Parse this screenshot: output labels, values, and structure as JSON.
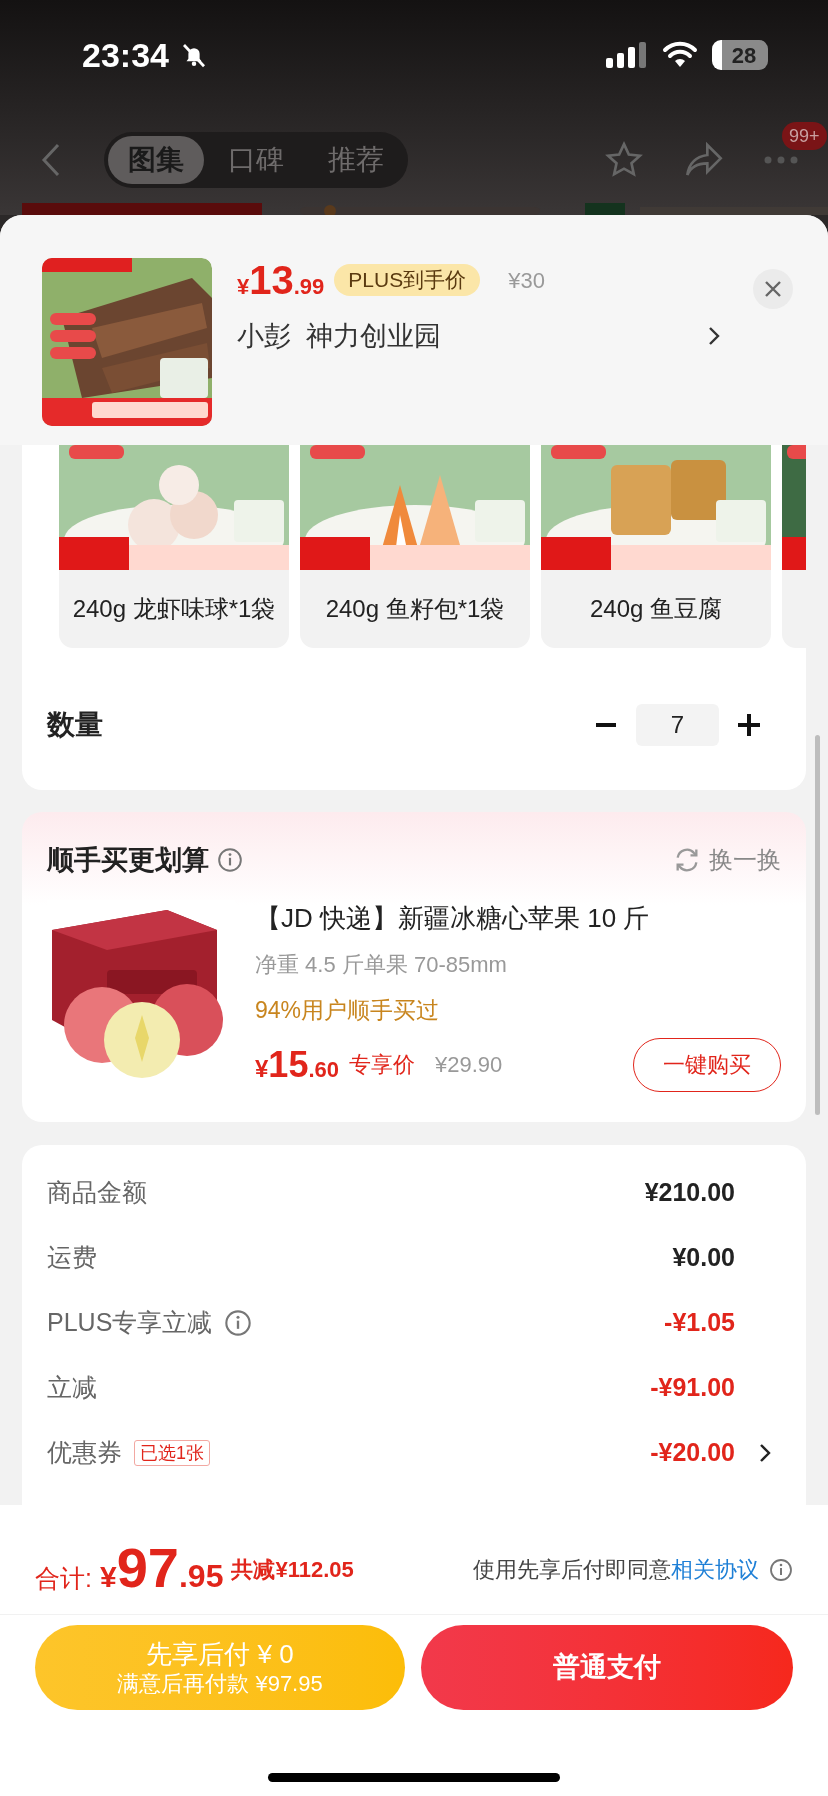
{
  "status_bar": {
    "time": "23:34",
    "battery": "28"
  },
  "nav": {
    "tabs": [
      {
        "label": "图集",
        "selected": true
      },
      {
        "label": "口碑",
        "selected": false
      },
      {
        "label": "推荐",
        "selected": false
      }
    ],
    "badge": "99+"
  },
  "sheet_header": {
    "price_symbol": "¥",
    "price_int": "13",
    "price_dec": ".99",
    "plus_label": "PLUS到手价",
    "original_price": "¥30",
    "address": "小彭  神力创业园"
  },
  "options": [
    {
      "label": "240g 龙虾味球*1袋"
    },
    {
      "label": "240g 鱼籽包*1袋"
    },
    {
      "label": "240g 鱼豆腐"
    }
  ],
  "quantity": {
    "label": "数量",
    "value": "7"
  },
  "addon": {
    "title": "顺手买更划算",
    "refresh": "换一换",
    "product": {
      "title": "【JD 快递】新疆冰糖心苹果 10 斤",
      "spec": "净重 4.5 斤单果 70-85mm",
      "social": "94%用户顺手买过",
      "price_symbol": "¥",
      "price_int": "15",
      "price_dec": ".60",
      "price_label": "专享价",
      "original_price": "¥29.90",
      "button": "一键购买"
    }
  },
  "summary": [
    {
      "label": "商品金额",
      "value": "¥210.00",
      "kind": "plain",
      "info": false,
      "link": false
    },
    {
      "label": "运费",
      "value": "¥0.00",
      "kind": "plain",
      "info": false,
      "link": false
    },
    {
      "label": "PLUS专享立减",
      "value": "-¥1.05",
      "kind": "discount",
      "info": true,
      "link": false
    },
    {
      "label": "立减",
      "value": "-¥91.00",
      "kind": "discount",
      "info": false,
      "link": false
    },
    {
      "label": "优惠券",
      "value": "-¥20.00",
      "kind": "discount",
      "tag": "已选1张",
      "info": false,
      "link": true
    }
  ],
  "footer": {
    "total_label": "合计:",
    "total_symbol": "¥",
    "total_int": "97",
    "total_dec": ".95",
    "saved": "共减¥112.05",
    "agreement_text": "使用先享后付即同意",
    "agreement_link": "相关协议",
    "pay_later": {
      "title": "先享后付 ¥ 0",
      "subtitle": "满意后再付款 ¥97.95"
    },
    "pay_now": "普通支付"
  }
}
